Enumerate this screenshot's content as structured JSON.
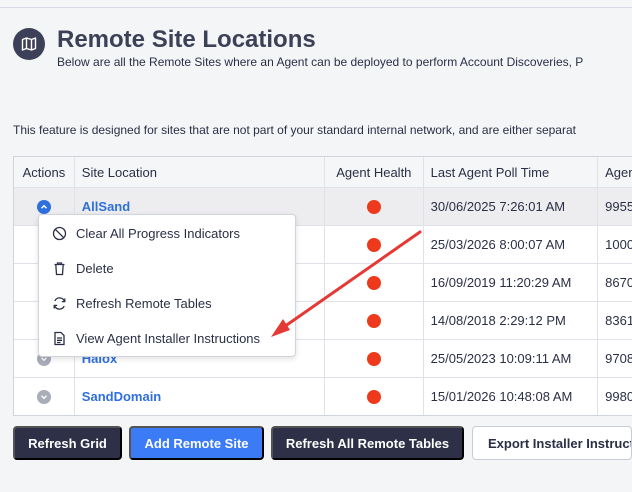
{
  "header": {
    "title": "Remote Site Locations",
    "subtitle": "Below are all the Remote Sites where an Agent can be deployed to perform Account Discoveries, P",
    "icon": "map-icon"
  },
  "note": "This feature is designed for sites that are not part of your standard internal network, and are either separat",
  "grid": {
    "columns": [
      "Actions",
      "Site Location",
      "Agent Health",
      "Last Agent Poll Time",
      "Agen"
    ],
    "rows": [
      {
        "site": "AllSand",
        "health": "red",
        "poll": "30/06/2025 7:26:01 AM",
        "agent": "9955"
      },
      {
        "site": "",
        "health": "red",
        "poll": "25/03/2026 8:00:07 AM",
        "agent": "1000"
      },
      {
        "site": "",
        "health": "red",
        "poll": "16/09/2019 11:20:29 AM",
        "agent": "8670"
      },
      {
        "site": "",
        "health": "red",
        "poll": "14/08/2018 2:29:12 PM",
        "agent": "8361"
      },
      {
        "site": "Halox",
        "health": "red",
        "poll": "25/05/2023 10:09:11 AM",
        "agent": "9708"
      },
      {
        "site": "SandDomain",
        "health": "red",
        "poll": "15/01/2026 10:48:08 AM",
        "agent": "9980"
      }
    ]
  },
  "context_menu": {
    "items": [
      {
        "label": "Clear All Progress Indicators",
        "icon": "ban-icon"
      },
      {
        "label": "Delete",
        "icon": "trash-icon"
      },
      {
        "label": "Refresh Remote Tables",
        "icon": "refresh-icon"
      },
      {
        "label": "View Agent Installer Instructions",
        "icon": "document-icon"
      }
    ]
  },
  "buttons": {
    "refresh_grid": "Refresh Grid",
    "add_remote_site": "Add Remote Site",
    "refresh_all": "Refresh All Remote Tables",
    "export": "Export Installer Instructi"
  },
  "colors": {
    "accent": "#3b7bf5",
    "dark_button": "#2d3047",
    "health_error": "#ee3a1c",
    "annotation_arrow": "#e53935"
  }
}
